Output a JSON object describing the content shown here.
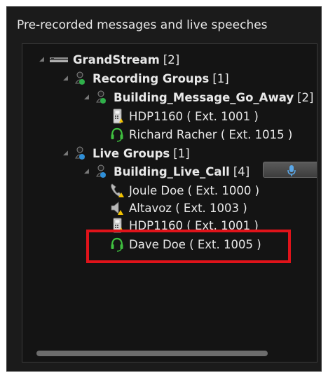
{
  "panel": {
    "title": "Pre-recorded messages and live speeches"
  },
  "tree": {
    "root": {
      "label": "GrandStream",
      "count": "[2]"
    },
    "recording_groups": {
      "label": "Recording Groups",
      "count": "[1]"
    },
    "building_message": {
      "label": "Building_Message_Go_Away",
      "count": "[2]"
    },
    "hdp1160_a": {
      "label": "HDP1160 ( Ext. 1001 )"
    },
    "richard": {
      "label": "Richard Racher ( Ext. 1015 )"
    },
    "live_groups": {
      "label": "Live Groups",
      "count": "[1]"
    },
    "building_live": {
      "label": "Building_Live_Call",
      "count": "[4]"
    },
    "joule": {
      "label": "Joule Doe ( Ext. 1000 )"
    },
    "altavoz": {
      "label": "Altavoz ( Ext. 1003 )"
    },
    "hdp1160_b": {
      "label": "HDP1160 ( Ext. 1001 )"
    },
    "dave": {
      "label": "Dave Doe ( Ext. 1005 )"
    }
  },
  "colors": {
    "highlight": "#e0131a",
    "headset": "#3fbf3f",
    "group_blue": "#2f8fd8",
    "mic": "#5aa7e8"
  },
  "icons": [
    "server-icon",
    "group-icon",
    "phone-device-icon",
    "headset-icon",
    "handset-icon",
    "speaker-icon",
    "microphone-icon"
  ]
}
